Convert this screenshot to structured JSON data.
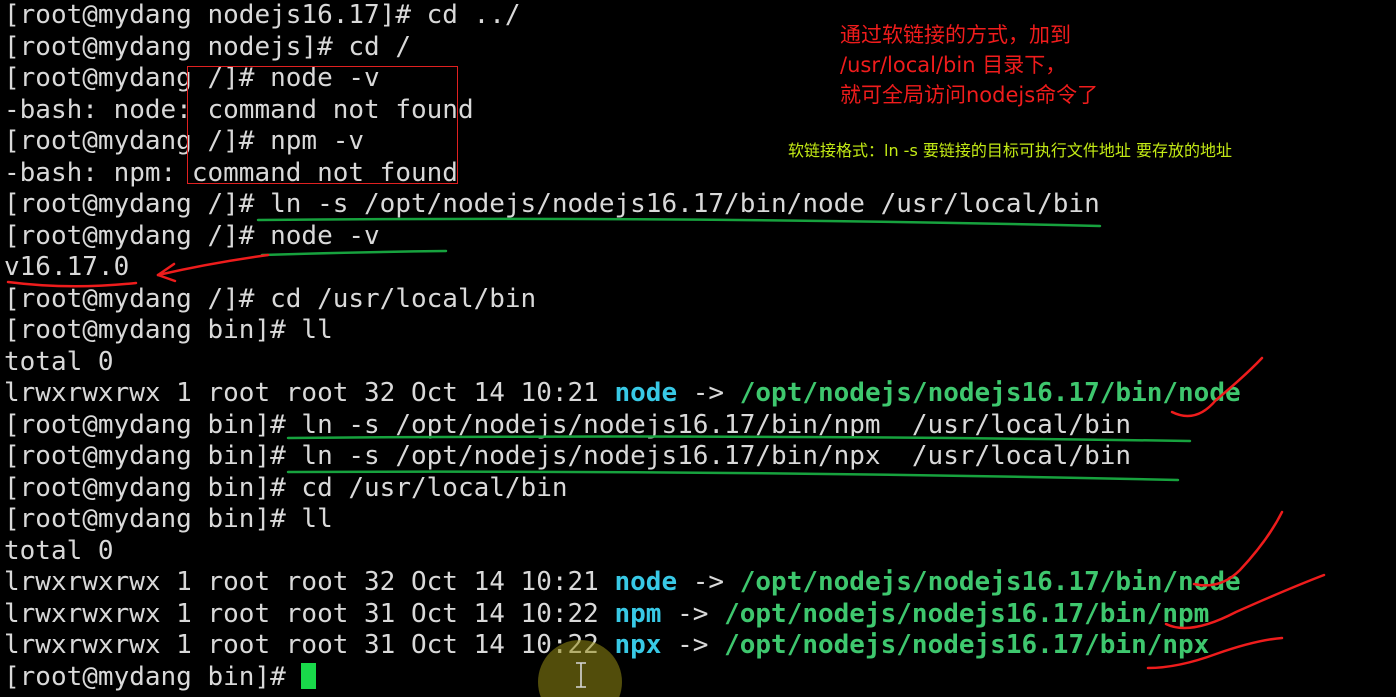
{
  "terminal": {
    "lines": [
      "[root@mydang nodejs16.17]# cd ../",
      "[root@mydang nodejs]# cd /",
      "[root@mydang /]# node -v",
      "-bash: node: command not found",
      "[root@mydang /]# npm -v",
      "-bash: npm: command not found",
      "[root@mydang /]# ln -s /opt/nodejs/nodejs16.17/bin/node /usr/local/bin",
      "[root@mydang /]# node -v",
      "v16.17.0",
      "[root@mydang /]# cd /usr/local/bin",
      "[root@mydang bin]# ll",
      "total 0",
      {
        "pre": "lrwxrwxrwx 1 root root 32 Oct 14 10:21 ",
        "name": "node",
        "arrow": " -> ",
        "target": "/opt/nodejs/nodejs16.17/bin/node"
      },
      "[root@mydang bin]# ln -s /opt/nodejs/nodejs16.17/bin/npm  /usr/local/bin",
      "[root@mydang bin]# ln -s /opt/nodejs/nodejs16.17/bin/npx  /usr/local/bin",
      "[root@mydang bin]# cd /usr/local/bin",
      "[root@mydang bin]# ll",
      "total 0",
      {
        "pre": "lrwxrwxrwx 1 root root 32 Oct 14 10:21 ",
        "name": "node",
        "arrow": " -> ",
        "target": "/opt/nodejs/nodejs16.17/bin/node"
      },
      {
        "pre": "lrwxrwxrwx 1 root root 31 Oct 14 10:22 ",
        "name": "npm",
        "arrow": " -> ",
        "target": "/opt/nodejs/nodejs16.17/bin/npm"
      },
      {
        "pre": "lrwxrwxrwx 1 root root 31 Oct 14 10:22 ",
        "name": "npx",
        "arrow": " -> ",
        "target": "/opt/nodejs/nodejs16.17/bin/npx"
      }
    ],
    "prompt": "[root@mydang bin]# "
  },
  "annotations": {
    "red_note": "通过软链接的方式，加到\n/usr/local/bin 目录下，\n就可全局访问nodejs命令了",
    "yellow_note": "软链接格式：ln -s 要链接的目标可执行文件地址 要存放的地址"
  },
  "colors": {
    "background": "#000000",
    "text": "#d9d9d9",
    "link_name": "#38c9e6",
    "link_target": "#3ec76e",
    "cursor": "#19d94a",
    "annotation_red": "#f01c1c",
    "annotation_yellow": "#c3ea15",
    "underline_green": "#17a23e"
  },
  "icons": {
    "cursor": "block-cursor-icon",
    "mouse": "i-beam-cursor-icon"
  }
}
